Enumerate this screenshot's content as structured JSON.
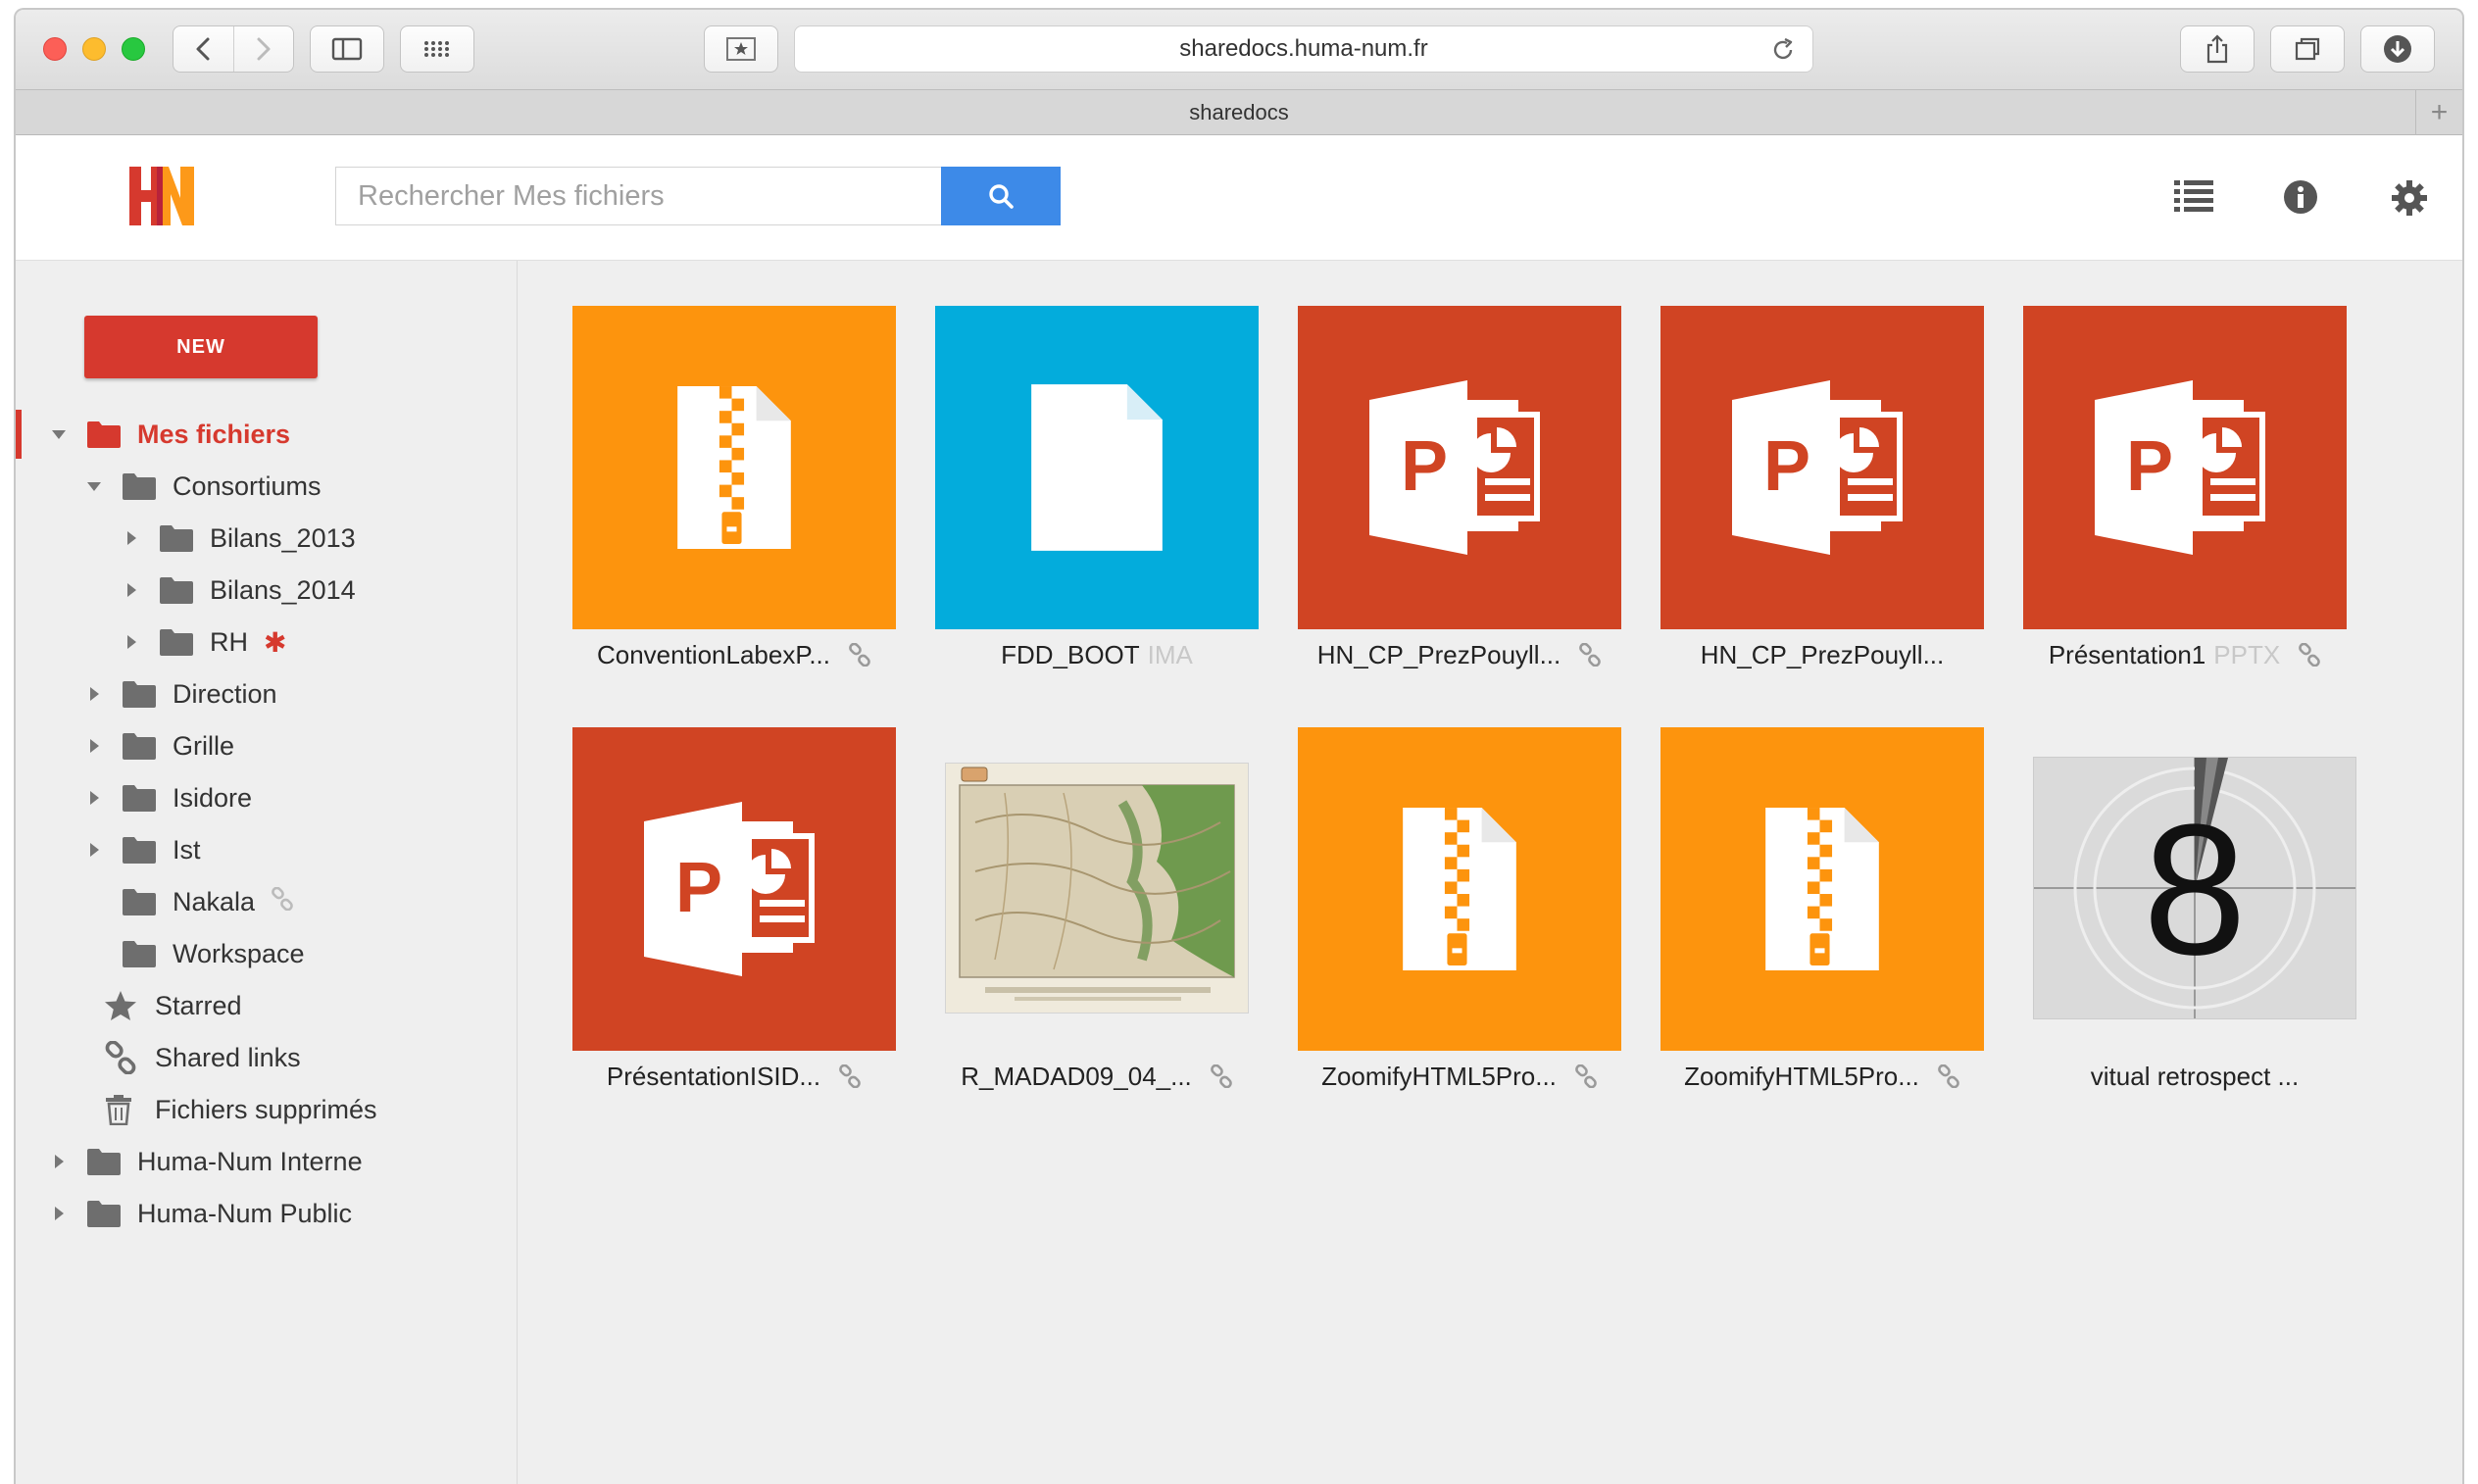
{
  "browser": {
    "url": "sharedocs.huma-num.fr",
    "tab_title": "sharedocs",
    "new_tab_label": "+"
  },
  "header": {
    "logo_text": "HN",
    "search_placeholder": "Rechercher Mes fichiers"
  },
  "sidebar": {
    "new_label": "NEW",
    "items": [
      {
        "label": "Mes fichiers"
      },
      {
        "label": "Consortiums"
      },
      {
        "label": "Bilans_2013"
      },
      {
        "label": "Bilans_2014"
      },
      {
        "label": "RH",
        "badge": "✱"
      },
      {
        "label": "Direction"
      },
      {
        "label": "Grille"
      },
      {
        "label": "Isidore"
      },
      {
        "label": "Ist"
      },
      {
        "label": "Nakala"
      },
      {
        "label": "Workspace"
      },
      {
        "label": "Starred"
      },
      {
        "label": "Shared links"
      },
      {
        "label": "Fichiers supprimés"
      },
      {
        "label": "Huma-Num Interne"
      },
      {
        "label": "Huma-Num Public"
      }
    ]
  },
  "files": [
    {
      "name": "ConventionLabexP...",
      "ext": "",
      "type": "zip",
      "color": "#fd940d",
      "linked": true
    },
    {
      "name": "FDD_BOOT",
      "ext": "IMA",
      "type": "file",
      "color": "#03acdc",
      "linked": false
    },
    {
      "name": "HN_CP_PrezPouyll...",
      "ext": "",
      "type": "ppt",
      "color": "#d04423",
      "linked": true
    },
    {
      "name": "HN_CP_PrezPouyll...",
      "ext": "",
      "type": "ppt",
      "color": "#d04423",
      "linked": false
    },
    {
      "name": "Présentation1",
      "ext": "PPTX",
      "type": "ppt",
      "color": "#d04423",
      "linked": true
    },
    {
      "name": "PrésentationISID...",
      "ext": "",
      "type": "ppt",
      "color": "#d04423",
      "linked": true
    },
    {
      "name": "R_MADAD09_04_...",
      "ext": "",
      "type": "map",
      "color": "#e8e3d4",
      "linked": true
    },
    {
      "name": "ZoomifyHTML5Pro...",
      "ext": "",
      "type": "zip",
      "color": "#fd940d",
      "linked": true
    },
    {
      "name": "ZoomifyHTML5Pro...",
      "ext": "",
      "type": "zip",
      "color": "#fd940d",
      "linked": true
    },
    {
      "name": "vitual retrospect ...",
      "ext": "",
      "type": "film",
      "color": "#d9d9d9",
      "linked": false,
      "number": "8"
    }
  ]
}
